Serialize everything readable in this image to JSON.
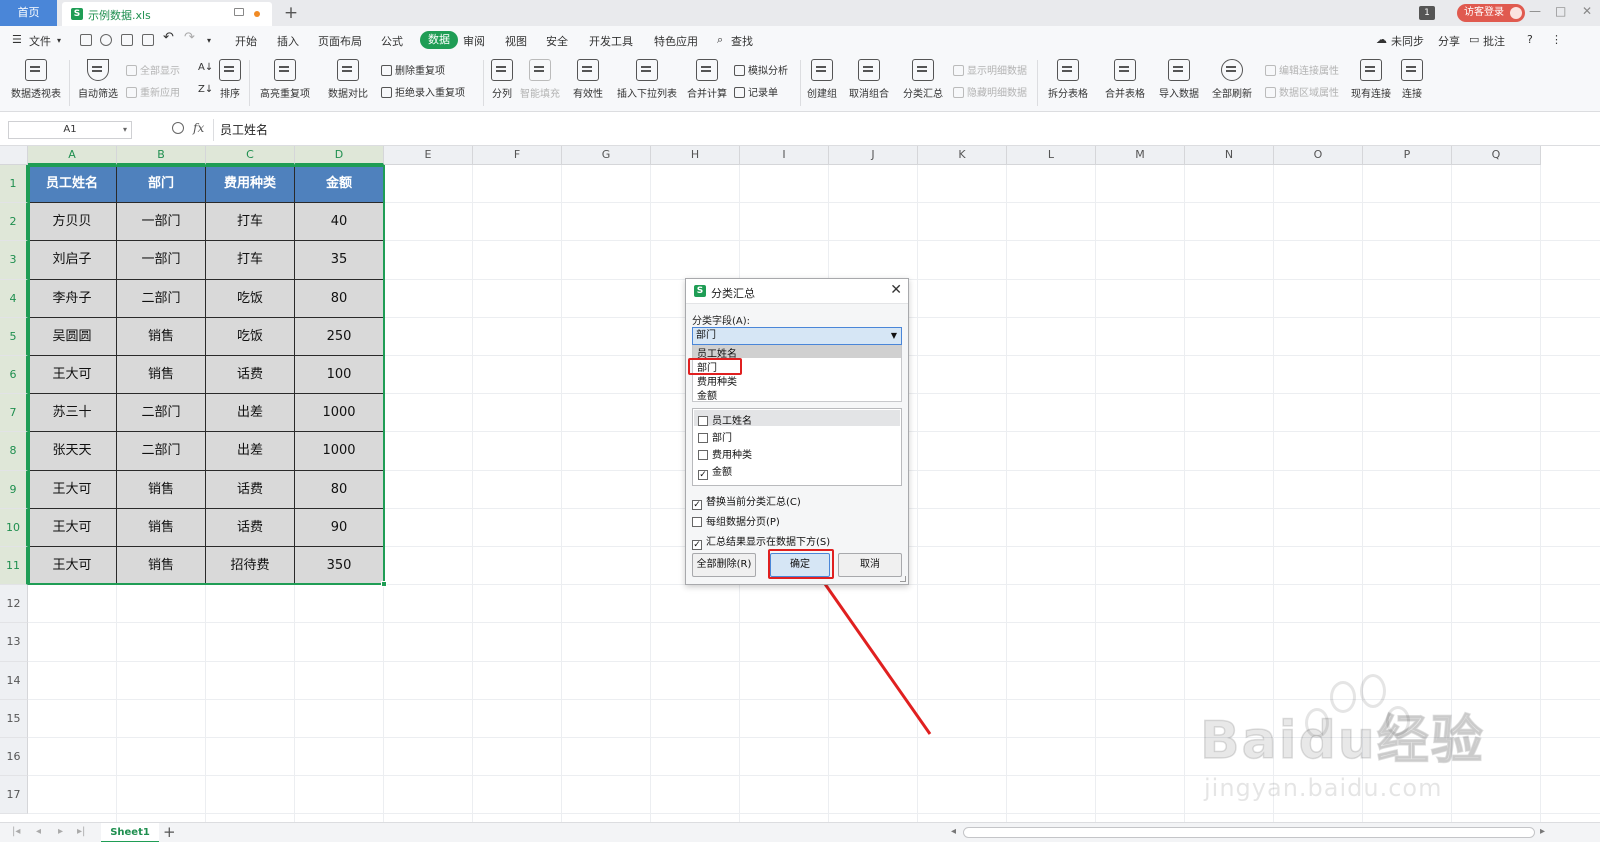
{
  "tabs": {
    "home": "首页",
    "file": "示例数据.xls",
    "new_tab": "+"
  },
  "titlebar": {
    "window_count": "1",
    "guest_login": "访客登录"
  },
  "menu": {
    "file": "文件",
    "items": [
      "开始",
      "插入",
      "页面布局",
      "公式",
      "数据",
      "审阅",
      "视图",
      "安全",
      "开发工具",
      "特色应用"
    ],
    "active": "数据",
    "search": "查找",
    "sync": "未同步",
    "share": "分享",
    "comment": "批注",
    "help": "?"
  },
  "ribbon": {
    "pivot": "数据透视表",
    "autofilter": "自动筛选",
    "show_all": "全部显示",
    "reapply": "重新应用",
    "sort": "排序",
    "highlight_dup": "高亮重复项",
    "compare": "数据对比",
    "remove_dup": "删除重复项",
    "reject_dup": "拒绝录入重复项",
    "split": "分列",
    "smart_fill": "智能填充",
    "validity": "有效性",
    "dropdown_list": "插入下拉列表",
    "consolidate": "合并计算",
    "whatif": "模拟分析",
    "record": "记录单",
    "group": "创建组",
    "ungroup": "取消组合",
    "subtotal": "分类汇总",
    "show_detail": "显示明细数据",
    "hide_detail": "隐藏明细数据",
    "split_table": "拆分表格",
    "merge_table": "合并表格",
    "import": "导入数据",
    "refresh_all": "全部刷新",
    "edit_conn": "编辑连接属性",
    "data_range": "数据区域属性",
    "existing_conn": "现有连接",
    "connect": "连接"
  },
  "formula": {
    "cell_ref": "A1",
    "fx": "fx",
    "value": "员工姓名"
  },
  "columns": [
    "A",
    "B",
    "C",
    "D",
    "E",
    "F",
    "G",
    "H",
    "I",
    "J",
    "K",
    "L",
    "M",
    "N",
    "O",
    "P",
    "Q"
  ],
  "rows": [
    "1",
    "2",
    "3",
    "4",
    "5",
    "6",
    "7",
    "8",
    "9",
    "10",
    "11",
    "12",
    "13",
    "14",
    "15",
    "16",
    "17"
  ],
  "table": {
    "headers": [
      "员工姓名",
      "部门",
      "费用种类",
      "金额"
    ],
    "rows": [
      [
        "方贝贝",
        "一部门",
        "打车",
        "40"
      ],
      [
        "刘启子",
        "一部门",
        "打车",
        "35"
      ],
      [
        "李舟子",
        "二部门",
        "吃饭",
        "80"
      ],
      [
        "吴圆圆",
        "销售",
        "吃饭",
        "250"
      ],
      [
        "王大可",
        "销售",
        "话费",
        "100"
      ],
      [
        "苏三十",
        "二部门",
        "出差",
        "1000"
      ],
      [
        "张天天",
        "二部门",
        "出差",
        "1000"
      ],
      [
        "王大可",
        "销售",
        "话费",
        "80"
      ],
      [
        "王大可",
        "销售",
        "话费",
        "90"
      ],
      [
        "王大可",
        "销售",
        "招待费",
        "350"
      ]
    ]
  },
  "dialog": {
    "title": "分类汇总",
    "field_label": "分类字段(A):",
    "field_value": "部门",
    "field_options": [
      "员工姓名",
      "部门",
      "费用种类",
      "金额"
    ],
    "summary_items": [
      {
        "label": "员工姓名",
        "checked": false
      },
      {
        "label": "部门",
        "checked": false
      },
      {
        "label": "费用种类",
        "checked": false
      },
      {
        "label": "金额",
        "checked": true
      }
    ],
    "options": [
      {
        "label": "替换当前分类汇总(C)",
        "checked": true
      },
      {
        "label": "每组数据分页(P)",
        "checked": false
      },
      {
        "label": "汇总结果显示在数据下方(S)",
        "checked": true
      }
    ],
    "remove_all": "全部删除(R)",
    "ok": "确定",
    "cancel": "取消",
    "check_mark": "✓"
  },
  "sheet": {
    "name": "Sheet1",
    "add": "+"
  },
  "watermark": {
    "brand": "Bai",
    "brand2": "du",
    "cn": "经验",
    "url": "jingyan.baidu.com"
  },
  "colors": {
    "accent": "#1f9d55",
    "header_fill": "#4f81bd",
    "cell_fill": "#d9d9d9",
    "annotation": "#e02020"
  }
}
